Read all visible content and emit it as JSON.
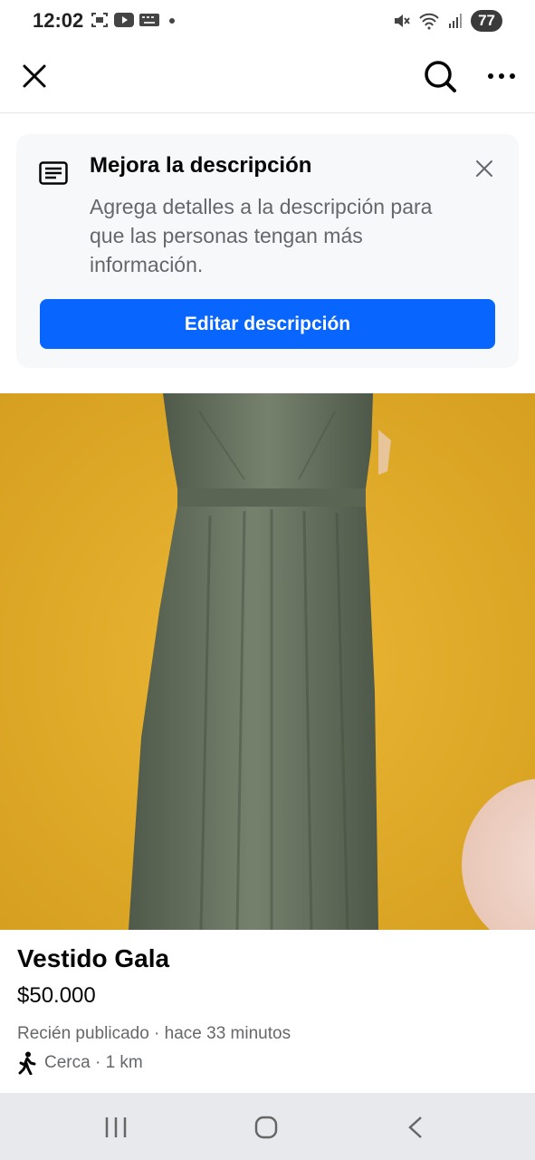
{
  "status_bar": {
    "time": "12:02",
    "battery": "77",
    "icons_left": [
      "screenshot-icon",
      "youtube-icon",
      "keyboard-icon",
      "dot-icon"
    ],
    "icons_right": [
      "mute-icon",
      "wifi-icon",
      "signal-icon"
    ]
  },
  "top_bar": {
    "icons": [
      "close-icon",
      "search-icon",
      "more-icon"
    ]
  },
  "tip": {
    "title": "Mejora la descripción",
    "body": "Agrega detalles a la descripción para que las personas tengan más información.",
    "button_label": "Editar descripción"
  },
  "listing": {
    "title": "Vestido Gala",
    "price": "$50.000",
    "meta": "Recién publicado · hace 33 minutos",
    "location": "Cerca · 1 km"
  },
  "colors": {
    "accent": "#0866ff",
    "photo_background": "#e0ad27",
    "dress": "#65725f"
  },
  "nav_bar": {
    "icons": [
      "recent-apps-icon",
      "home-icon",
      "back-icon"
    ]
  }
}
